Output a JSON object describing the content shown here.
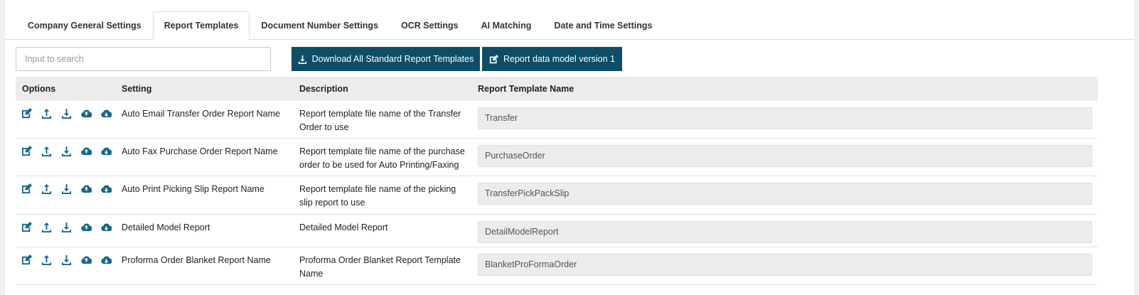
{
  "tabs": [
    {
      "label": "Company General Settings",
      "active": false
    },
    {
      "label": "Report Templates",
      "active": true
    },
    {
      "label": "Document Number Settings",
      "active": false
    },
    {
      "label": "OCR Settings",
      "active": false
    },
    {
      "label": "AI Matching",
      "active": false
    },
    {
      "label": "Date and Time Settings",
      "active": false
    }
  ],
  "toolbar": {
    "search_placeholder": "Input to search",
    "download_label": "Download All Standard Report Templates",
    "model_label": "Report data model version 1"
  },
  "table": {
    "headers": {
      "options": "Options",
      "setting": "Setting",
      "description": "Description",
      "template_name": "Report Template Name"
    },
    "rows": [
      {
        "setting": "Auto Email Transfer Order Report Name",
        "description": "Report template file name of the Transfer Order to use",
        "template_name": "Transfer"
      },
      {
        "setting": "Auto Fax Purchase Order Report Name",
        "description": "Report template file name of the purchase order to be used for Auto Printing/Faxing",
        "template_name": "PurchaseOrder"
      },
      {
        "setting": "Auto Print Picking Slip Report Name",
        "description": "Report template file name of the picking slip report to use",
        "template_name": "TransferPickPackSlip"
      },
      {
        "setting": "Detailed Model Report",
        "description": "Detailed Model Report",
        "template_name": "DetailModelReport"
      },
      {
        "setting": "Proforma Order Blanket Report Name",
        "description": "Proforma Order Blanket Report Template Name",
        "template_name": "BlanketProFormaOrder"
      }
    ]
  },
  "icons": [
    "edit-icon",
    "upload-icon",
    "download-icon",
    "cloud-upload-icon",
    "cloud-download-icon"
  ],
  "colors": {
    "accent": "#0d4d66",
    "icon": "#17678a",
    "header_bg": "#ececec"
  }
}
